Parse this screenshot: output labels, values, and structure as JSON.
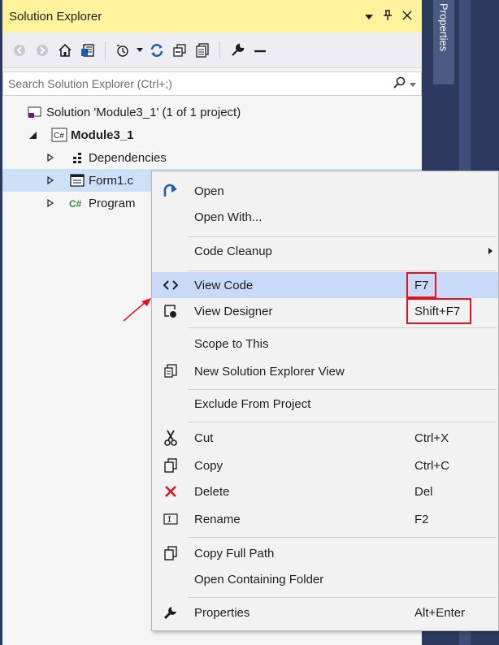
{
  "panel": {
    "title": "Solution Explorer",
    "search_placeholder": "Search Solution Explorer (Ctrl+;)"
  },
  "tree": {
    "solution": "Solution 'Module3_1' (1 of 1 project)",
    "project": "Module3_1",
    "dependencies": "Dependencies",
    "form": "Form1.c",
    "program": "Program"
  },
  "side_tab": {
    "label": "Properties"
  },
  "menu": {
    "open": "Open",
    "open_with": "Open With...",
    "code_cleanup": "Code Cleanup",
    "view_code": "View Code",
    "view_code_shortcut": "F7",
    "view_designer": "View Designer",
    "view_designer_shortcut": "Shift+F7",
    "scope_to_this": "Scope to This",
    "new_view": "New Solution Explorer View",
    "exclude": "Exclude From Project",
    "cut": "Cut",
    "cut_shortcut": "Ctrl+X",
    "copy": "Copy",
    "copy_shortcut": "Ctrl+C",
    "delete": "Delete",
    "delete_shortcut": "Del",
    "rename": "Rename",
    "rename_shortcut": "F2",
    "copy_full_path": "Copy Full Path",
    "open_folder": "Open Containing Folder",
    "properties": "Properties",
    "properties_shortcut": "Alt+Enter"
  },
  "colors": {
    "title_bar": "#fff29d",
    "selection": "#cce0f7",
    "menu_hover": "#c9daf8",
    "highlight_box": "#e8111a",
    "dark_side": "#2b3a5e"
  }
}
